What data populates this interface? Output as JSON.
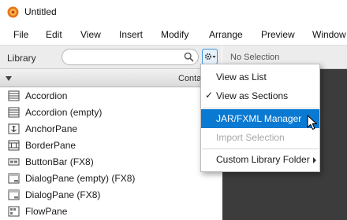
{
  "window": {
    "title": "Untitled",
    "icon": "scene-builder-icon"
  },
  "menubar": {
    "items": [
      "File",
      "Edit",
      "View",
      "Insert",
      "Modify",
      "Arrange",
      "Preview",
      "Window"
    ]
  },
  "library": {
    "title": "Library",
    "search_placeholder": "",
    "section_header": "Containers",
    "items": [
      {
        "label": "Accordion",
        "icon": "accordion-icon"
      },
      {
        "label": "Accordion  (empty)",
        "icon": "accordion-icon"
      },
      {
        "label": "AnchorPane",
        "icon": "anchorpane-icon"
      },
      {
        "label": "BorderPane",
        "icon": "borderpane-icon"
      },
      {
        "label": "ButtonBar  (FX8)",
        "icon": "buttonbar-icon"
      },
      {
        "label": "DialogPane (empty)  (FX8)",
        "icon": "dialogpane-icon"
      },
      {
        "label": "DialogPane  (FX8)",
        "icon": "dialogpane-icon"
      },
      {
        "label": "FlowPane",
        "icon": "flowpane-icon"
      }
    ]
  },
  "inspector": {
    "header": "No Selection"
  },
  "context_menu": {
    "items": [
      {
        "label": "View as List",
        "checked": false,
        "enabled": true,
        "highlighted": false
      },
      {
        "label": "View as Sections",
        "checked": true,
        "enabled": true,
        "highlighted": false
      },
      {
        "label": "JAR/FXML Manager",
        "checked": false,
        "enabled": true,
        "highlighted": true
      },
      {
        "label": "Import Selection",
        "checked": false,
        "enabled": false,
        "highlighted": false
      },
      {
        "label": "Custom Library Folder",
        "checked": false,
        "enabled": true,
        "highlighted": false,
        "submenu": true
      }
    ],
    "check_glyph": "✓"
  },
  "colors": {
    "accent": "#0a79d1",
    "canvas": "#3c3c3c",
    "panel": "#f4f4f4"
  }
}
